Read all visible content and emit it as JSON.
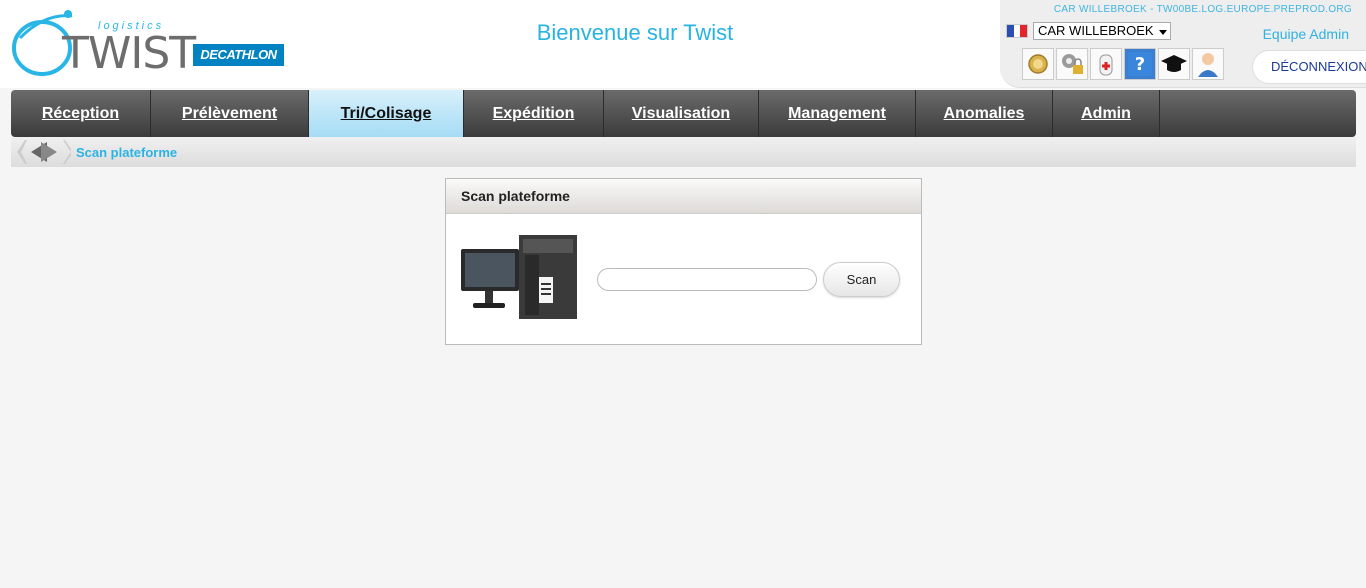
{
  "header": {
    "logo_sub": "logistics",
    "logo_text": "TWIST",
    "brand": "DECATHLON",
    "welcome": "Bienvenue sur Twist"
  },
  "user_panel": {
    "environment": "CAR WILLEBROEK - TW00BE.LOG.EUROPE.PREPROD.ORG",
    "site": "CAR WILLEBROEK",
    "team": "Equipe Admin",
    "logout": "DÉCONNEXION",
    "tools": [
      {
        "icon": "medal-icon"
      },
      {
        "icon": "settings-lock-icon"
      },
      {
        "icon": "first-aid-icon"
      },
      {
        "icon": "help-icon"
      },
      {
        "icon": "graduation-cap-icon"
      },
      {
        "icon": "user-icon"
      }
    ]
  },
  "nav": {
    "items": [
      {
        "label": "Réception"
      },
      {
        "label": "Prélèvement"
      },
      {
        "label": "Tri/Colisage",
        "active": true
      },
      {
        "label": "Expédition"
      },
      {
        "label": "Visualisation"
      },
      {
        "label": "Management"
      },
      {
        "label": "Anomalies"
      },
      {
        "label": "Admin"
      }
    ]
  },
  "breadcrumb": {
    "current": "Scan plateforme"
  },
  "panel": {
    "title": "Scan plateforme",
    "input_value": "",
    "scan_button": "Scan"
  },
  "colors": {
    "accent": "#27b3e3",
    "brand": "#0082c3",
    "nav_bg": "#4a4a4a",
    "nav_active": "#a5dcf5"
  }
}
